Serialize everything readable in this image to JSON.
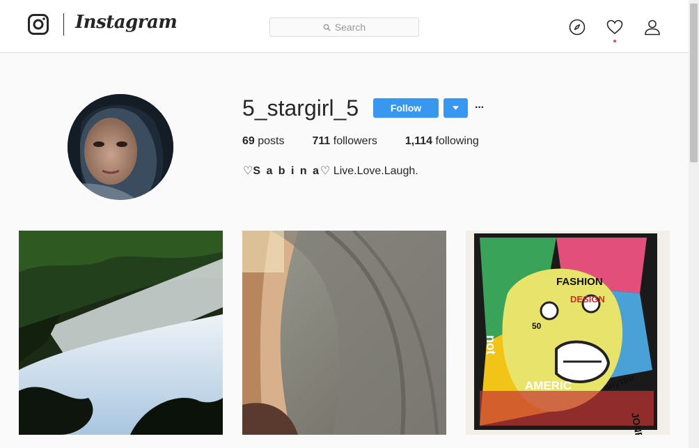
{
  "header": {
    "brand": "Instagram",
    "search_placeholder": "Search",
    "icons": [
      "instagram-glyph-icon",
      "compass-icon",
      "heart-icon",
      "user-icon",
      "search-icon"
    ]
  },
  "profile": {
    "username": "5_stargirl_5",
    "follow_label": "Follow",
    "more_label": "···",
    "stats": {
      "posts_count": "69",
      "posts_label": "posts",
      "followers_count": "711",
      "followers_label": "followers",
      "following_count": "1,114",
      "following_label": "following"
    },
    "bio_prefix": "♡",
    "bio_name": "S a b i n a",
    "bio_rest": "♡ Live.Love.Laugh."
  },
  "colors": {
    "accent": "#3897f0",
    "notification": "#ed4956",
    "border": "#dbdbdb",
    "background": "#fafafa"
  },
  "posts": [
    {
      "subject": "river-reflection-photo"
    },
    {
      "subject": "hair-selfie-photo"
    },
    {
      "subject": "pop-art-collage-photo",
      "texts": [
        "FASHION",
        "DESIGN",
        "50",
        "AMERIC",
        "not",
        "внутри",
        "JONE"
      ]
    }
  ]
}
